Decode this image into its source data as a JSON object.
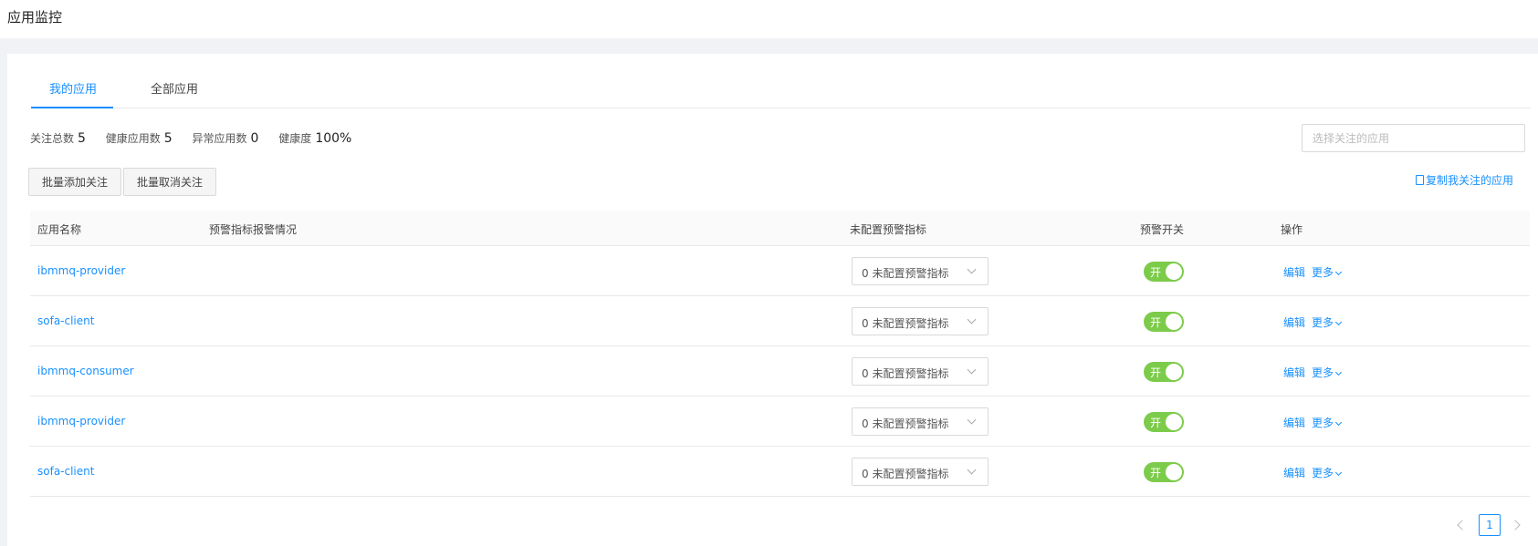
{
  "page": {
    "title": "应用监控"
  },
  "tabs": [
    {
      "label": "我的应用",
      "active": true
    },
    {
      "label": "全部应用",
      "active": false
    }
  ],
  "stats": [
    {
      "label": "关注总数",
      "value": "5"
    },
    {
      "label": "健康应用数",
      "value": "5"
    },
    {
      "label": "异常应用数",
      "value": "0"
    },
    {
      "label": "健康度",
      "value": "100%"
    }
  ],
  "search": {
    "placeholder": "选择关注的应用"
  },
  "actions": {
    "batch_add": "批量添加关注",
    "batch_cancel": "批量取消关注",
    "copy_link": "复制我关注的应用"
  },
  "table": {
    "headers": [
      "应用名称",
      "预警指标报警情况",
      "未配置预警指标",
      "预警开关",
      "操作"
    ],
    "rows": [
      {
        "name": "ibmmq-provider",
        "unconfigured": "0 未配置预警指标",
        "switch_label": "开",
        "edit": "编辑",
        "more": "更多"
      },
      {
        "name": "sofa-client",
        "unconfigured": "0 未配置预警指标",
        "switch_label": "开",
        "edit": "编辑",
        "more": "更多"
      },
      {
        "name": "ibmmq-consumer",
        "unconfigured": "0 未配置预警指标",
        "switch_label": "开",
        "edit": "编辑",
        "more": "更多"
      },
      {
        "name": "ibmmq-provider",
        "unconfigured": "0 未配置预警指标",
        "switch_label": "开",
        "edit": "编辑",
        "more": "更多"
      },
      {
        "name": "sofa-client",
        "unconfigured": "0 未配置预警指标",
        "switch_label": "开",
        "edit": "编辑",
        "more": "更多"
      }
    ]
  },
  "pagination": {
    "current": "1"
  },
  "colors": {
    "accent": "#1890ff",
    "switch_on": "#7ccb4a"
  }
}
